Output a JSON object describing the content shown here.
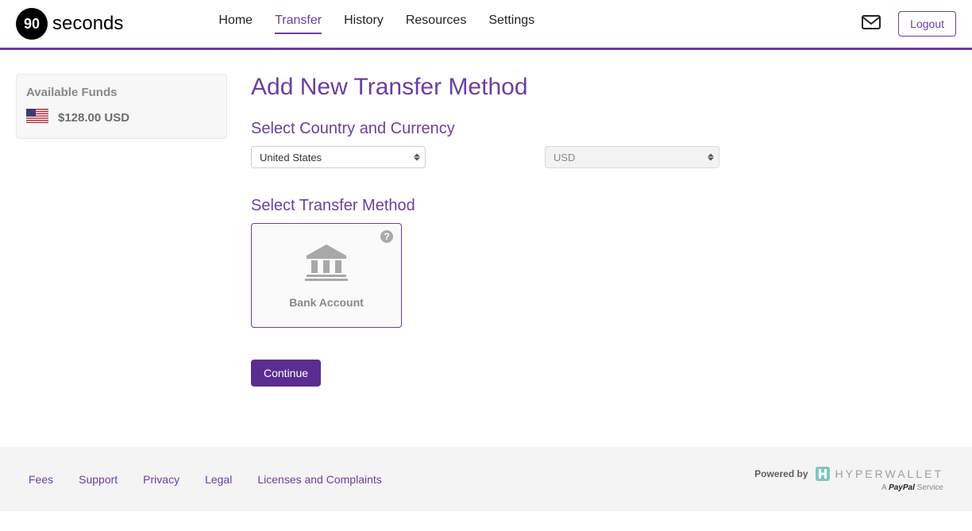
{
  "brand": {
    "mark": "90",
    "name": "seconds"
  },
  "nav": {
    "items": [
      {
        "label": "Home",
        "active": false
      },
      {
        "label": "Transfer",
        "active": true
      },
      {
        "label": "History",
        "active": false
      },
      {
        "label": "Resources",
        "active": false
      },
      {
        "label": "Settings",
        "active": false
      }
    ]
  },
  "header": {
    "logout_label": "Logout"
  },
  "sidebar": {
    "funds_title": "Available Funds",
    "funds_amount": "$128.00 USD",
    "flag_country": "United States"
  },
  "main": {
    "page_title": "Add New Transfer Method",
    "section_country_currency": "Select Country and Currency",
    "country_selected": "United States",
    "currency_selected": "USD",
    "section_transfer_method": "Select Transfer Method",
    "method_card_label": "Bank Account",
    "continue_label": "Continue"
  },
  "footer": {
    "links": [
      {
        "label": "Fees"
      },
      {
        "label": "Support"
      },
      {
        "label": "Privacy"
      },
      {
        "label": "Legal"
      },
      {
        "label": "Licenses and Complaints"
      }
    ],
    "powered_by": "Powered by",
    "hyperwallet": "HYPERWALLET",
    "paypal_prefix": "A ",
    "paypal_brand": "PayPal",
    "paypal_suffix": " Service"
  }
}
